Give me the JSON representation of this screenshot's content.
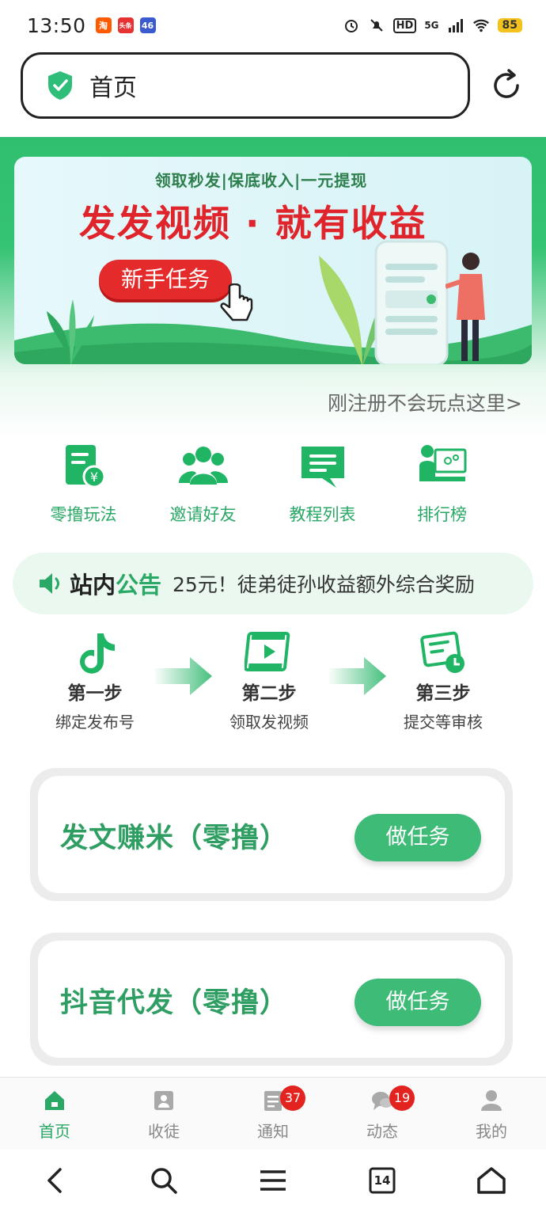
{
  "status_bar": {
    "time": "13:50",
    "network": "5G",
    "hd": "HD",
    "battery": "85",
    "apps": [
      {
        "name": "taobao-app-icon",
        "glyph": "淘",
        "color": "#ff5a00"
      },
      {
        "name": "toutiao-app-icon",
        "glyph": "头条",
        "color": "#e63232"
      },
      {
        "name": "game-app-icon",
        "glyph": "46",
        "color": "#3a5bd0"
      }
    ]
  },
  "address_bar": {
    "title": "首页"
  },
  "banner": {
    "subtitle": "领取秒发|保底收入|一元提现",
    "title": "发发视频 · 就有收益",
    "button": "新手任务"
  },
  "newbie_link": "刚注册不会玩点这里>",
  "quick_menu": [
    {
      "label": "零撸玩法",
      "icon": "document-yuan-icon"
    },
    {
      "label": "邀请好友",
      "icon": "people-icon"
    },
    {
      "label": "教程列表",
      "icon": "message-list-icon"
    },
    {
      "label": "排行榜",
      "icon": "ranking-monitor-icon"
    }
  ],
  "notice": {
    "head_part1": "站内",
    "head_part2": "公告",
    "text": "25元！徒弟徒孙收益额外综合奖励"
  },
  "steps": [
    {
      "title": "第一步",
      "desc": "绑定发布号",
      "icon": "tiktok-icon"
    },
    {
      "title": "第二步",
      "desc": "领取发视频",
      "icon": "video-film-icon"
    },
    {
      "title": "第三步",
      "desc": "提交等审核",
      "icon": "review-clock-icon"
    }
  ],
  "tasks": [
    {
      "title": "发文赚米（零撸）",
      "button": "做任务"
    },
    {
      "title": "抖音代发（零撸）",
      "button": "做任务"
    }
  ],
  "tabs": [
    {
      "label": "首页",
      "icon": "home-icon",
      "active": true,
      "badge": ""
    },
    {
      "label": "收徒",
      "icon": "recruit-icon",
      "active": false,
      "badge": ""
    },
    {
      "label": "通知",
      "icon": "notice-icon",
      "active": false,
      "badge": "37"
    },
    {
      "label": "动态",
      "icon": "chat-icon",
      "active": false,
      "badge": "19"
    },
    {
      "label": "我的",
      "icon": "user-icon",
      "active": false,
      "badge": ""
    }
  ],
  "system_nav": {
    "tabs_count": "14"
  },
  "colors": {
    "brand_green": "#2aa866",
    "banner_red": "#e0242b",
    "badge_red": "#e3231f"
  }
}
